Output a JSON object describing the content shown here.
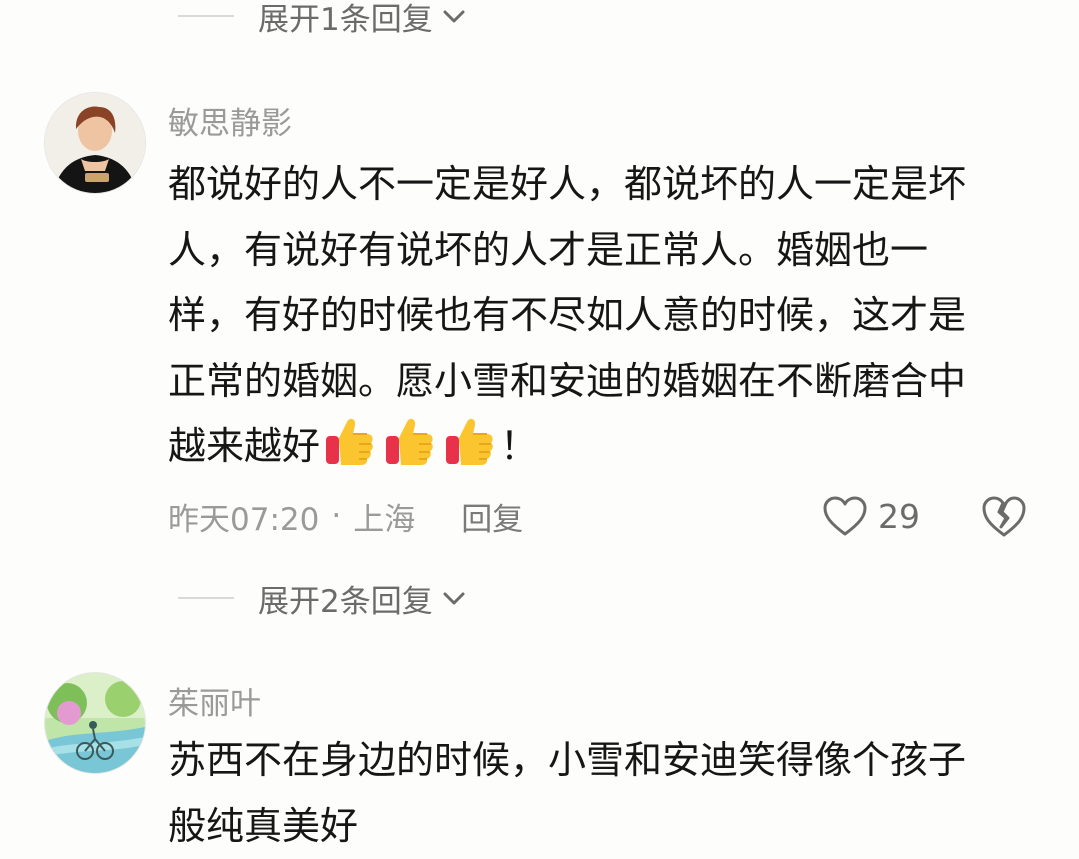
{
  "comments": [
    {
      "expand_label": "展开1条回复"
    },
    {
      "username": "敏思静影",
      "avatar_icon": "woman-portrait-avatar",
      "text_lines": [
        "都说好的人不一定是好人，都说坏的人一定是坏",
        "人，有说好有说坏的人才是正常人。婚姻也一",
        "样，有好的时候也有不尽如人意的时候，这才是",
        "正常的婚姻。愿小雪和安迪的婚姻在不断磨合中"
      ],
      "last_line_text": "越来越好",
      "last_line_suffix": "！",
      "emoji": "thumbs-up",
      "emoji_count": 3,
      "time": "昨天07:20",
      "separator": "·",
      "location": "上海",
      "reply_label": "回复",
      "like_count": "29",
      "expand_label": "展开2条回复"
    },
    {
      "username": "茱丽叶",
      "avatar_icon": "landscape-cyclist-avatar",
      "text_lines": [
        "苏西不在身边的时候，小雪和安迪笑得像个孩子",
        "般纯真美好"
      ]
    }
  ],
  "colors": {
    "username": "#9a9a9a",
    "text": "#161616",
    "meta": "#9a9a9a",
    "background": "#fdfdfb"
  }
}
